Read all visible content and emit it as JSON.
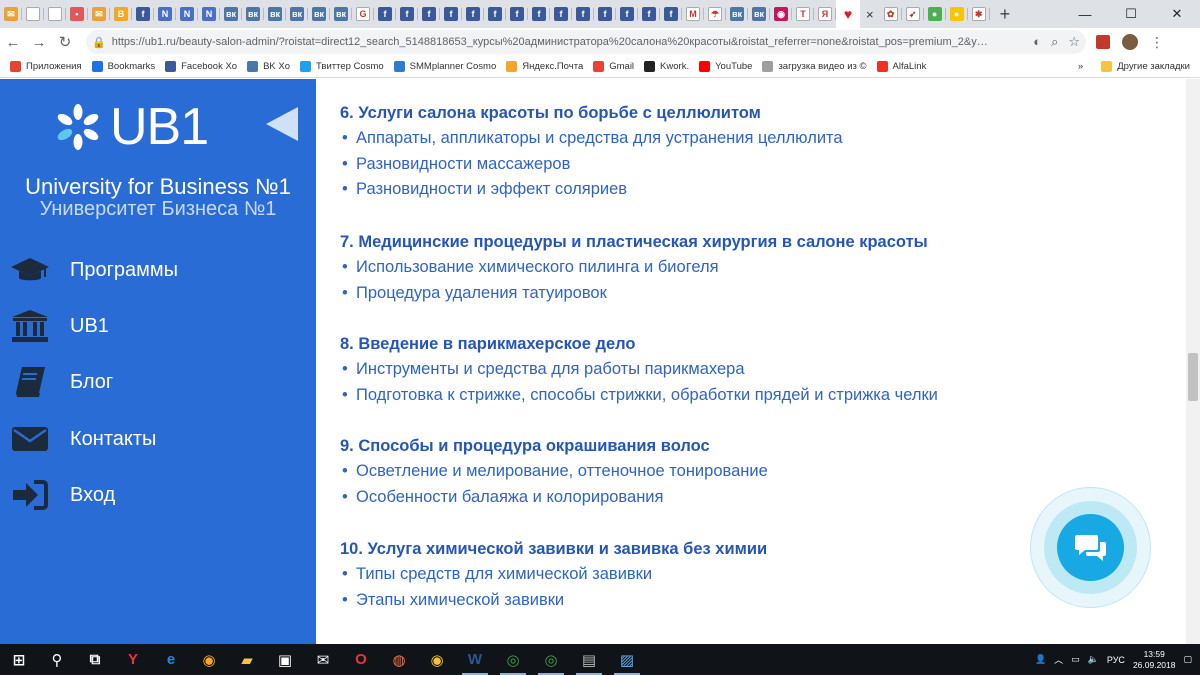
{
  "browser": {
    "tabs": [
      {
        "icon": "gmail-icon",
        "color": "#e8a33d",
        "glyph": "✉"
      },
      {
        "icon": "page-icon",
        "color": "#ffffff",
        "glyph": ""
      },
      {
        "icon": "page-icon",
        "color": "#ffffff",
        "glyph": ""
      },
      {
        "icon": "pinterest-icon",
        "color": "#e25858",
        "glyph": "•"
      },
      {
        "icon": "gmail-icon",
        "color": "#e8a33d",
        "glyph": "✉"
      },
      {
        "icon": "b-icon",
        "color": "#f5a623",
        "glyph": "B"
      },
      {
        "icon": "facebook-icon",
        "color": "#3b5998",
        "glyph": "f"
      },
      {
        "icon": "n-icon",
        "color": "#4a6fc9",
        "glyph": "N"
      },
      {
        "icon": "n-icon",
        "color": "#4a6fc9",
        "glyph": "N"
      },
      {
        "icon": "n-icon",
        "color": "#4a6fc9",
        "glyph": "N"
      },
      {
        "icon": "vk-icon",
        "color": "#4a76a8",
        "glyph": "вк"
      },
      {
        "icon": "vk-icon",
        "color": "#4a76a8",
        "glyph": "вк"
      },
      {
        "icon": "vk-icon",
        "color": "#4a76a8",
        "glyph": "вк"
      },
      {
        "icon": "vk-icon",
        "color": "#4a76a8",
        "glyph": "вк"
      },
      {
        "icon": "vk-icon",
        "color": "#4a76a8",
        "glyph": "вк"
      },
      {
        "icon": "vk-icon",
        "color": "#4a76a8",
        "glyph": "вк"
      },
      {
        "icon": "google-icon",
        "color": "#ffffff",
        "glyph": "G"
      },
      {
        "icon": "facebook-icon",
        "color": "#3b5998",
        "glyph": "f"
      },
      {
        "icon": "facebook-icon",
        "color": "#3b5998",
        "glyph": "f"
      },
      {
        "icon": "facebook-icon",
        "color": "#3b5998",
        "glyph": "f"
      },
      {
        "icon": "facebook-icon",
        "color": "#3b5998",
        "glyph": "f"
      },
      {
        "icon": "facebook-icon",
        "color": "#3b5998",
        "glyph": "f"
      },
      {
        "icon": "facebook-icon",
        "color": "#3b5998",
        "glyph": "f"
      },
      {
        "icon": "facebook-icon",
        "color": "#3b5998",
        "glyph": "f"
      },
      {
        "icon": "facebook-icon",
        "color": "#3b5998",
        "glyph": "f"
      },
      {
        "icon": "facebook-icon",
        "color": "#3b5998",
        "glyph": "f"
      },
      {
        "icon": "facebook-icon",
        "color": "#3b5998",
        "glyph": "f"
      },
      {
        "icon": "facebook-icon",
        "color": "#3b5998",
        "glyph": "f"
      },
      {
        "icon": "facebook-icon",
        "color": "#3b5998",
        "glyph": "f"
      },
      {
        "icon": "facebook-icon",
        "color": "#3b5998",
        "glyph": "f"
      },
      {
        "icon": "facebook-icon",
        "color": "#3b5998",
        "glyph": "f"
      },
      {
        "icon": "gmail-icon",
        "color": "#ffffff",
        "glyph": "M"
      },
      {
        "icon": "umbrella-icon",
        "color": "#ffffff",
        "glyph": "☂"
      },
      {
        "icon": "vk-icon",
        "color": "#4a76a8",
        "glyph": "вк"
      },
      {
        "icon": "vk-icon",
        "color": "#4a76a8",
        "glyph": "вк"
      },
      {
        "icon": "camera-icon",
        "color": "#c2185b",
        "glyph": "◉"
      },
      {
        "icon": "t-icon",
        "color": "#ffffff",
        "glyph": "T"
      },
      {
        "icon": "yandex-icon",
        "color": "#ffffff",
        "glyph": "Я"
      }
    ],
    "active_tab": {
      "icon": "heart-icon",
      "color": "#e31b23",
      "glyph": "♥",
      "close": "×"
    },
    "extra_tabs": [
      {
        "icon": "flower-icon",
        "color": "#ffffff",
        "glyph": "✿"
      },
      {
        "icon": "cursor-icon",
        "color": "#ffffff",
        "glyph": "➶"
      },
      {
        "icon": "apple-icon",
        "color": "#4caf50",
        "glyph": "●"
      },
      {
        "icon": "beeline-icon",
        "color": "#f7c600",
        "glyph": "●"
      },
      {
        "icon": "star-icon",
        "color": "#ffffff",
        "glyph": "✱"
      }
    ],
    "new_tab": "+",
    "window_controls": {
      "minimize": "—",
      "maximize": "☐",
      "close": "✕"
    },
    "url": "https://ub1.ru/beauty-salon-admin/?roistat=direct12_search_5148818653_курсы%20администратора%20салона%20красоты&roistat_referrer=none&roistat_pos=premium_2&yclid=564...",
    "bookmarks": [
      {
        "icon": "apps-icon",
        "color": "#e94235",
        "label": "Приложения"
      },
      {
        "icon": "star-icon",
        "color": "#1a73e8",
        "label": "Bookmarks"
      },
      {
        "icon": "facebook-icon",
        "color": "#3b5998",
        "label": "Facebook Xo"
      },
      {
        "icon": "vk-icon",
        "color": "#4a76a8",
        "label": "BK Xo"
      },
      {
        "icon": "twitter-icon",
        "color": "#1da1f2",
        "label": "Твиттер Cosmo"
      },
      {
        "icon": "smmplanner-icon",
        "color": "#2e7bd6",
        "label": "SMMplanner Cosmo"
      },
      {
        "icon": "yandex-mail-icon",
        "color": "#f5a623",
        "label": "Яндекс.Почта"
      },
      {
        "icon": "gmail-icon",
        "color": "#ea4335",
        "label": "Gmail"
      },
      {
        "icon": "kwork-icon",
        "color": "#222222",
        "label": "Kwork."
      },
      {
        "icon": "youtube-icon",
        "color": "#ff0000",
        "label": "YouTube"
      },
      {
        "icon": "page-icon",
        "color": "#9e9e9e",
        "label": "загрузка видео из ©"
      },
      {
        "icon": "alfa-icon",
        "color": "#ef3124",
        "label": "AlfaLink"
      }
    ],
    "bookmarks_more": "»",
    "other_bookmarks": "Другие закладки"
  },
  "sidebar": {
    "logo_text": "UB1",
    "tagline_en": "University for Business №1",
    "tagline_ru": "Университет Бизнеса №1",
    "nav": [
      {
        "icon": "graduation-cap-icon",
        "label": "Программы"
      },
      {
        "icon": "institution-icon",
        "label": "UB1"
      },
      {
        "icon": "book-icon",
        "label": "Блог"
      },
      {
        "icon": "envelope-icon",
        "label": "Контакты"
      },
      {
        "icon": "sign-in-icon",
        "label": "Вход"
      }
    ]
  },
  "content": {
    "sections": [
      {
        "title": "6. Услуги салона красоты по борьбе с целлюлитом",
        "items": [
          "Аппараты, аппликаторы и средства для устранения целлюлита",
          "Разновидности массажеров",
          "Разновидности и эффект соляриев"
        ]
      },
      {
        "title": "7. Медицинские процедуры и пластическая хирургия в салоне красоты",
        "items": [
          "Использование химического пилинга и биогеля",
          "Процедура удаления татуировок"
        ]
      },
      {
        "title": "8. Введение в парикмахерское дело",
        "items": [
          "Инструменты и средства для работы парикмахера",
          "Подготовка к стрижке, способы стрижки, обработки прядей и стрижка челки"
        ]
      },
      {
        "title": "9. Способы и процедура окрашивания волос",
        "items": [
          "Осветление и мелирование, оттеночное тонирование",
          "Особенности балаяжа и колорирования"
        ]
      },
      {
        "title": "10. Услуга химической завивки и завивка без химии",
        "items": [
          "Типы средств для химической завивки",
          "Этапы химической завивки"
        ]
      }
    ]
  },
  "taskbar": {
    "apps": [
      {
        "icon": "windows-start-icon",
        "open": false
      },
      {
        "icon": "search-icon",
        "open": false
      },
      {
        "icon": "task-view-icon",
        "open": false
      },
      {
        "icon": "yandex-browser-icon",
        "open": false
      },
      {
        "icon": "edge-icon",
        "open": false
      },
      {
        "icon": "chrome-canary-icon",
        "open": false
      },
      {
        "icon": "file-explorer-icon",
        "open": false
      },
      {
        "icon": "store-icon",
        "open": false
      },
      {
        "icon": "mail-icon",
        "open": false
      },
      {
        "icon": "opera-icon",
        "open": false
      },
      {
        "icon": "firefox-icon",
        "open": false
      },
      {
        "icon": "yandex-icon",
        "open": false
      },
      {
        "icon": "word-icon",
        "open": true
      },
      {
        "icon": "chrome-icon",
        "open": true
      },
      {
        "icon": "chrome-icon",
        "open": true
      },
      {
        "icon": "network-app-icon",
        "open": true
      },
      {
        "icon": "photos-icon",
        "open": true
      }
    ],
    "language": "РУС",
    "time": "13:59",
    "date": "26.09.2018"
  },
  "colors": {
    "sidebar": "#2a6cd5",
    "link": "#2e63c7",
    "heading": "#2556b6",
    "chat": "#18a9e4"
  }
}
